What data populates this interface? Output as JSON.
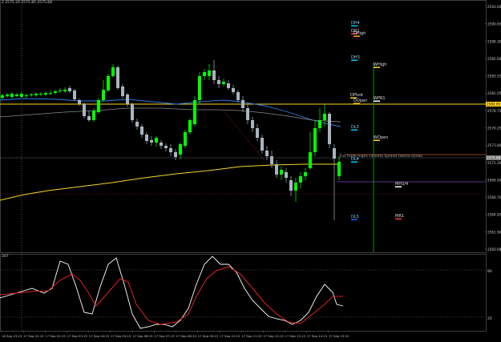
{
  "header": {
    "main_title": "2  2575.20  2575.85  2575.68",
    "sub_title": "207"
  },
  "colors": {
    "background": "#000000",
    "bull": "#00ff00",
    "bear": "#a9b4bf",
    "blue_ma": "#2e7be6",
    "grey_ma": "#8a8a8a",
    "yellow_ma": "#f5d62a",
    "stoch_main": "#ffffff",
    "stoch_signal": "#dd2222",
    "h_yellow": "#ffd21e",
    "h_orange": "#c0542a",
    "h_purple": "#8040c0",
    "vline_green": "#1a8a1a"
  },
  "price_axis": {
    "labels": [
      "2593.00",
      "2590.65",
      "2588.30",
      "2585.60",
      "2583.55",
      "2581.05",
      "2578.75",
      "2576.25",
      "2573.80",
      "2571.20",
      "2569.00",
      "2566.70",
      "2564.40",
      "2561.90",
      "2560.08"
    ],
    "highlight_yellow": "2582.65",
    "highlight_grey": "2575.68"
  },
  "time_axis": [
    "16 Sep 23:15",
    "17 Sep 01:15",
    "17 Sep 02:15",
    "17 Sep 03:15",
    "17 Sep 04:15",
    "17 Sep 05:15",
    "17 Sep 06:15",
    "17 Sep 07:15",
    "17 Sep 08:15",
    "17 Sep 09:15",
    "17 Sep 10:15",
    "17 Sep 11:15",
    "17 Sep 12:15",
    "17 Sep 13:15",
    "17 Sep 14:15",
    "17 Sep 15:15"
  ],
  "level_labels": {
    "dh4": "DH4",
    "dr1": "DR1",
    "dhigh": "DHigh",
    "dh3": "DH3",
    "whigh": "WHigh",
    "wpr1": "WPR1",
    "dpivot": "DPivot",
    "dopen": "DOpen",
    "dl3": "DL3",
    "wopen": "WOpen",
    "dl4": "DL4",
    "mh3_4": "MH3/4",
    "dl5": "DL5",
    "mr1": "MR1",
    "trend_text": "Trai  Trade Highs  Ohioma  Spread  Fatima  Ocean"
  },
  "stoch_axis": [
    "80",
    "20"
  ]
}
